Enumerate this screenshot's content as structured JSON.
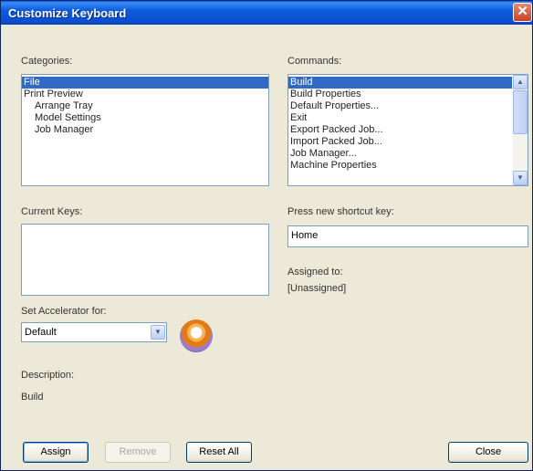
{
  "window": {
    "title": "Customize Keyboard",
    "close_glyph": "✕"
  },
  "categories": {
    "label": "Categories:",
    "items": [
      {
        "label": "File",
        "selected": true,
        "indent": false
      },
      {
        "label": "Print Preview",
        "selected": false,
        "indent": false
      },
      {
        "label": "Arrange Tray",
        "selected": false,
        "indent": true
      },
      {
        "label": "Model Settings",
        "selected": false,
        "indent": true
      },
      {
        "label": "Job Manager",
        "selected": false,
        "indent": true
      }
    ]
  },
  "commands": {
    "label": "Commands:",
    "items": [
      {
        "label": "Build",
        "selected": true
      },
      {
        "label": "Build Properties",
        "selected": false
      },
      {
        "label": "Default Properties...",
        "selected": false
      },
      {
        "label": "Exit",
        "selected": false
      },
      {
        "label": "Export Packed Job...",
        "selected": false
      },
      {
        "label": "Import Packed Job...",
        "selected": false
      },
      {
        "label": "Job Manager...",
        "selected": false
      },
      {
        "label": "Machine Properties",
        "selected": false
      }
    ]
  },
  "current_keys": {
    "label": "Current Keys:"
  },
  "shortcut": {
    "label": "Press new shortcut key:",
    "value": "Home"
  },
  "assigned": {
    "label": "Assigned to:",
    "value": "[Unassigned]"
  },
  "accelerator": {
    "label": "Set Accelerator for:",
    "value": "Default"
  },
  "description": {
    "label": "Description:",
    "value": "Build"
  },
  "buttons": {
    "assign": "Assign",
    "remove": "Remove",
    "reset_all": "Reset All",
    "close": "Close"
  },
  "icons": {
    "scroll_up": "▲",
    "scroll_down": "▼",
    "dropdown": "▼"
  }
}
